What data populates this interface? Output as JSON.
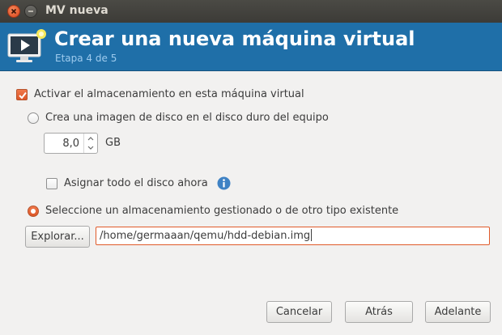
{
  "window": {
    "title": "MV nueva"
  },
  "banner": {
    "title": "Crear una nueva máquina virtual",
    "step": "Etapa 4 de 5",
    "icon": "monitor-play-icon"
  },
  "storage": {
    "enable_label": "Activar el almacenamiento en esta máquina virtual",
    "enable_checked": true,
    "create_option_label": "Crea una imagen de disco en el disco duro del equipo",
    "create_option_selected": false,
    "size_value": "8,0",
    "size_unit": "GB",
    "allocate_label": "Asignar todo el disco ahora",
    "allocate_checked": false,
    "existing_option_label": "Seleccione un almacenamiento gestionado o de otro tipo existente",
    "existing_option_selected": true,
    "browse_label": "Explorar...",
    "path_value": "/home/germaaan/qemu/hdd-debian.img"
  },
  "footer": {
    "cancel_label": "Cancelar",
    "back_label": "Atrás",
    "forward_label": "Adelante"
  },
  "colors": {
    "accent": "#dd5627",
    "banner": "#1f6fa8",
    "titlebar": "#3c3b37"
  }
}
